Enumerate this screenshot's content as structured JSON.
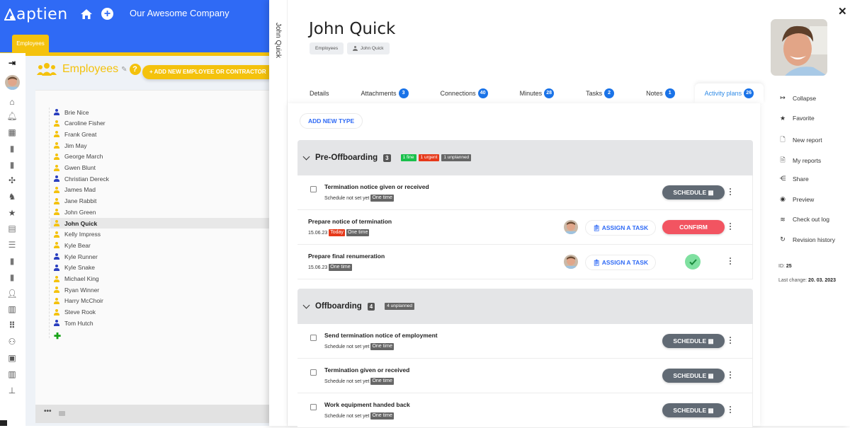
{
  "app": {
    "brand": "aptien",
    "company": "Our Awesome Company",
    "module_tab": "Employees",
    "colors": {
      "primary": "#2f6af5",
      "accent": "#f4c20d",
      "badge": "#1a73e8",
      "confirm": "#f25461",
      "schedule": "#616a74",
      "fine": "#19c04b",
      "urgent": "#e6391a"
    }
  },
  "rail_icons": [
    "collapse-panel-icon",
    "avatar",
    "home-icon",
    "bell-icon",
    "calendar-icon",
    "clipboard-icon",
    "clipboard-check-icon",
    "network-icon",
    "dog-icon",
    "star-icon",
    "report-icon",
    "list-icon",
    "clipboard-list-icon",
    "clipboard-alt-icon",
    "user-icon",
    "books-icon",
    "grid-icon",
    "team-icon",
    "reading-icon",
    "library-icon",
    "org-chart-icon"
  ],
  "list_page": {
    "title": "Employees",
    "add_button": "+ ADD NEW EMPLOYEE OR CONTRACTOR",
    "employees": [
      {
        "name": "Brie Nice",
        "type": "internal"
      },
      {
        "name": "Caroline Fisher",
        "type": "external"
      },
      {
        "name": "Frank Great",
        "type": "external"
      },
      {
        "name": "Jim May",
        "type": "external"
      },
      {
        "name": "George March",
        "type": "external"
      },
      {
        "name": "Gwen Blunt",
        "type": "external"
      },
      {
        "name": "Christian Dereck",
        "type": "internal"
      },
      {
        "name": "James Mad",
        "type": "external"
      },
      {
        "name": "Jane Rabbit",
        "type": "external"
      },
      {
        "name": "John Green",
        "type": "external"
      },
      {
        "name": "John Quick",
        "type": "external",
        "selected": true
      },
      {
        "name": "Kelly Impress",
        "type": "external"
      },
      {
        "name": "Kyle Bear",
        "type": "external"
      },
      {
        "name": "Kyle Runner",
        "type": "internal"
      },
      {
        "name": "Kyle Snake",
        "type": "internal"
      },
      {
        "name": "Michael King",
        "type": "external"
      },
      {
        "name": "Ryan Winner",
        "type": "external"
      },
      {
        "name": "Harry McChoir",
        "type": "external"
      },
      {
        "name": "Steve Rook",
        "type": "external"
      },
      {
        "name": "Tom Hutch",
        "type": "internal"
      }
    ],
    "footer_more": "•••"
  },
  "record": {
    "spine_label": "John Quick",
    "title": "John Quick",
    "breadcrumb": [
      "Employees",
      "John Quick"
    ],
    "tabs": [
      {
        "label": "Details"
      },
      {
        "label": "Attachments",
        "count": "3"
      },
      {
        "label": "Connections",
        "count": "40"
      },
      {
        "label": "Minutes",
        "count": "28"
      },
      {
        "label": "Tasks",
        "count": "2"
      },
      {
        "label": "Notes",
        "count": "1"
      },
      {
        "label": "Activity plans",
        "count": "26",
        "active": true
      }
    ],
    "add_type_label": "ADD NEW TYPE",
    "groups": [
      {
        "name": "Pre-Offboarding",
        "count": "3",
        "stats": [
          {
            "label": "1 fine",
            "color": "green"
          },
          {
            "label": "1 urgent",
            "color": "red"
          },
          {
            "label": "1 unplanned",
            "color": "grey"
          }
        ],
        "items": [
          {
            "title": "Termination notice given or received",
            "schedule": "Schedule not set yet",
            "chips": [
              {
                "label": "One time",
                "color": "grey"
              }
            ],
            "checkbox": true,
            "action": "schedule"
          },
          {
            "title": "Prepare notice of termination",
            "schedule": "15.06.23",
            "chips": [
              {
                "label": "Today",
                "color": "red"
              },
              {
                "label": "One time",
                "color": "grey"
              }
            ],
            "checkbox": false,
            "action": "confirm",
            "assign": true
          },
          {
            "title": "Prepare final renumeration",
            "schedule": "15.06.23",
            "chips": [
              {
                "label": "One time",
                "color": "grey"
              }
            ],
            "checkbox": false,
            "action": "done",
            "assign": true
          }
        ]
      },
      {
        "name": "Offboarding",
        "count": "4",
        "stats": [
          {
            "label": "4 unplanned",
            "color": "grey"
          }
        ],
        "items": [
          {
            "title": "Send termination notice of employment",
            "schedule": "Schedule not set yet",
            "chips": [
              {
                "label": "One time",
                "color": "grey"
              }
            ],
            "checkbox": true,
            "action": "schedule"
          },
          {
            "title": "Termination given or received",
            "schedule": "Schedule not set yet",
            "chips": [
              {
                "label": "One time",
                "color": "grey"
              }
            ],
            "checkbox": true,
            "action": "schedule"
          },
          {
            "title": "Work equipment handed back",
            "schedule": "Schedule not set yet",
            "chips": [
              {
                "label": "One time",
                "color": "grey"
              }
            ],
            "checkbox": true,
            "action": "schedule"
          }
        ]
      }
    ],
    "buttons": {
      "schedule": "SCHEDULE",
      "confirm": "CONFIRM",
      "assign": "ASSIGN A TASK"
    },
    "actions": [
      {
        "label": "Collapse",
        "icon": "collapse-icon"
      },
      {
        "label": "Favorite",
        "icon": "star-icon"
      },
      {
        "label": "New report",
        "icon": "new-report-icon"
      },
      {
        "label": "My reports",
        "icon": "my-reports-icon"
      },
      {
        "label": "Share",
        "icon": "share-icon"
      },
      {
        "label": "Preview",
        "icon": "eye-icon"
      },
      {
        "label": "Check out log",
        "icon": "checkout-log-icon"
      },
      {
        "label": "Revision history",
        "icon": "history-icon"
      }
    ],
    "meta": {
      "id_label": "ID:",
      "id": "25",
      "last_change_label": "Last change:",
      "last_change": "20. 03. 2023"
    }
  }
}
